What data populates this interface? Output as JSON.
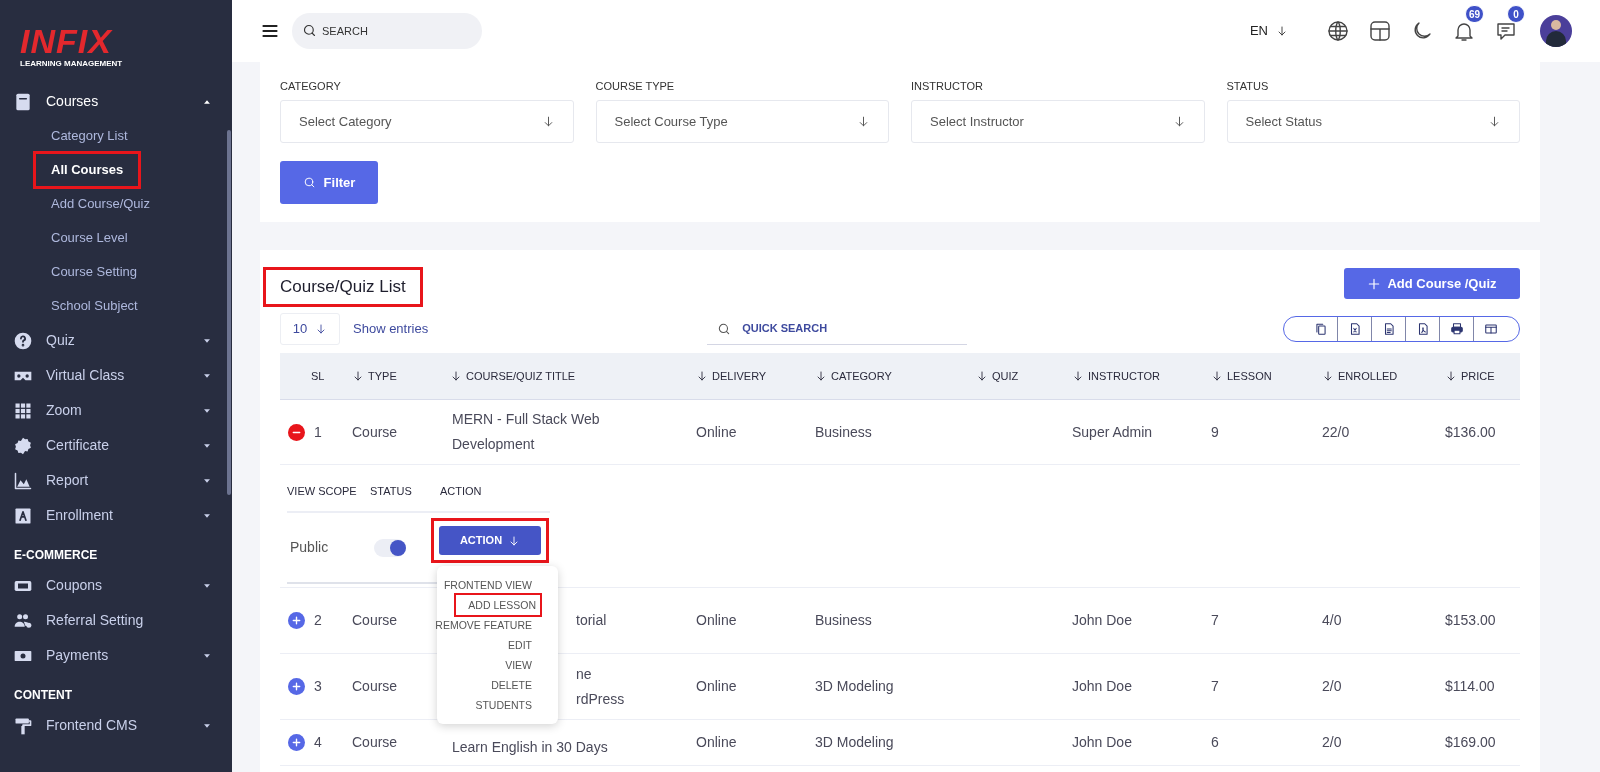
{
  "sidebar": {
    "logo": {
      "brand": "INFIX",
      "tagline": "LEARNING MANAGEMENT"
    },
    "sections": [
      {
        "items": [
          {
            "label": "Courses",
            "kind": "book",
            "expanded": true,
            "children": [
              {
                "label": "Category List",
                "selected": false,
                "highlighted": false
              },
              {
                "label": "All Courses",
                "selected": true,
                "highlighted": true
              },
              {
                "label": "Add Course/Quiz",
                "selected": false,
                "highlighted": false
              },
              {
                "label": "Course Level",
                "selected": false,
                "highlighted": false
              },
              {
                "label": "Course Setting",
                "selected": false,
                "highlighted": false
              },
              {
                "label": "School Subject",
                "selected": false,
                "highlighted": false
              }
            ]
          },
          {
            "label": "Quiz",
            "kind": "question",
            "expanded": false
          },
          {
            "label": "Virtual Class",
            "kind": "goggles",
            "expanded": false
          },
          {
            "label": "Zoom",
            "kind": "grid",
            "expanded": false
          },
          {
            "label": "Certificate",
            "kind": "badge",
            "expanded": false
          },
          {
            "label": "Report",
            "kind": "chart",
            "expanded": false
          },
          {
            "label": "Enrollment",
            "kind": "letter",
            "expanded": false
          }
        ]
      },
      {
        "heading": "E-COMMERCE",
        "items": [
          {
            "label": "Coupons",
            "kind": "ticket",
            "expanded": false
          },
          {
            "label": "Referral Setting",
            "kind": "users"
          },
          {
            "label": "Payments",
            "kind": "money",
            "expanded": false
          }
        ]
      },
      {
        "heading": "CONTENT",
        "items": [
          {
            "label": "Frontend CMS",
            "kind": "roller",
            "expanded": false
          }
        ]
      }
    ]
  },
  "topbar": {
    "search_placeholder": "SEARCH",
    "language": "EN",
    "notifications": "69",
    "messages": "0"
  },
  "filters": [
    {
      "label": "CATEGORY",
      "placeholder": "Select Category"
    },
    {
      "label": "COURSE TYPE",
      "placeholder": "Select Course Type"
    },
    {
      "label": "INSTRUCTOR",
      "placeholder": "Select Instructor"
    },
    {
      "label": "STATUS",
      "placeholder": "Select Status"
    }
  ],
  "filter_button": "Filter",
  "list": {
    "title": "Course/Quiz List",
    "title_highlighted": true,
    "add_button": "Add Course /Quiz",
    "page_size": "10",
    "page_size_label": "Show entries",
    "search_placeholder": "QUICK SEARCH"
  },
  "table": {
    "columns": [
      {
        "label": "SL",
        "sortable": false
      },
      {
        "label": "TYPE",
        "sortable": true
      },
      {
        "label": "COURSE/QUIZ TITLE",
        "sortable": true
      },
      {
        "label": "DELIVERY",
        "sortable": true
      },
      {
        "label": "CATEGORY",
        "sortable": true
      },
      {
        "label": "QUIZ",
        "sortable": true
      },
      {
        "label": "INSTRUCTOR",
        "sortable": true
      },
      {
        "label": "LESSON",
        "sortable": true
      },
      {
        "label": "ENROLLED",
        "sortable": true
      },
      {
        "label": "PRICE",
        "sortable": true
      }
    ],
    "rows": [
      {
        "sl": "1",
        "expanded": true,
        "type": "Course",
        "title": [
          "MERN - Full Stack Web",
          "Development"
        ],
        "title_partly_hidden": false,
        "delivery": "Online",
        "category": "Business",
        "instructor": "Super Admin",
        "lesson": "9",
        "enrolled": "22/0",
        "price": "$136.00"
      },
      {
        "sl": "2",
        "expanded": false,
        "type": "Course",
        "title": [
          "torial"
        ],
        "title_partly_hidden": true,
        "delivery": "Online",
        "category": "Business",
        "instructor": "John Doe",
        "lesson": "7",
        "enrolled": "4/0",
        "price": "$153.00"
      },
      {
        "sl": "3",
        "expanded": false,
        "type": "Course",
        "title": [
          "ne",
          "rdPress"
        ],
        "title_partly_hidden": true,
        "delivery": "Online",
        "category": "3D Modeling",
        "instructor": "John Doe",
        "lesson": "7",
        "enrolled": "2/0",
        "price": "$114.00"
      },
      {
        "sl": "4",
        "expanded": false,
        "type": "Course",
        "title": [
          "Learn English in 30 Days"
        ],
        "title_partly_hidden": false,
        "delivery": "Online",
        "category": "3D Modeling",
        "instructor": "John Doe",
        "lesson": "6",
        "enrolled": "2/0",
        "price": "$169.00"
      }
    ],
    "detail": {
      "columns": [
        "VIEW SCOPE",
        "STATUS",
        "ACTION"
      ],
      "view_scope": "Public",
      "status_on": true,
      "action_button": "ACTION",
      "action_highlighted": true,
      "menu": [
        {
          "label": "FRONTEND VIEW",
          "highlighted": false
        },
        {
          "label": "ADD LESSON",
          "highlighted": true
        },
        {
          "label": "REMOVE FEATURE",
          "highlighted": false
        },
        {
          "label": "EDIT",
          "highlighted": false
        },
        {
          "label": "VIEW",
          "highlighted": false
        },
        {
          "label": "DELETE",
          "highlighted": false
        },
        {
          "label": "STUDENTS",
          "highlighted": false
        }
      ]
    }
  }
}
